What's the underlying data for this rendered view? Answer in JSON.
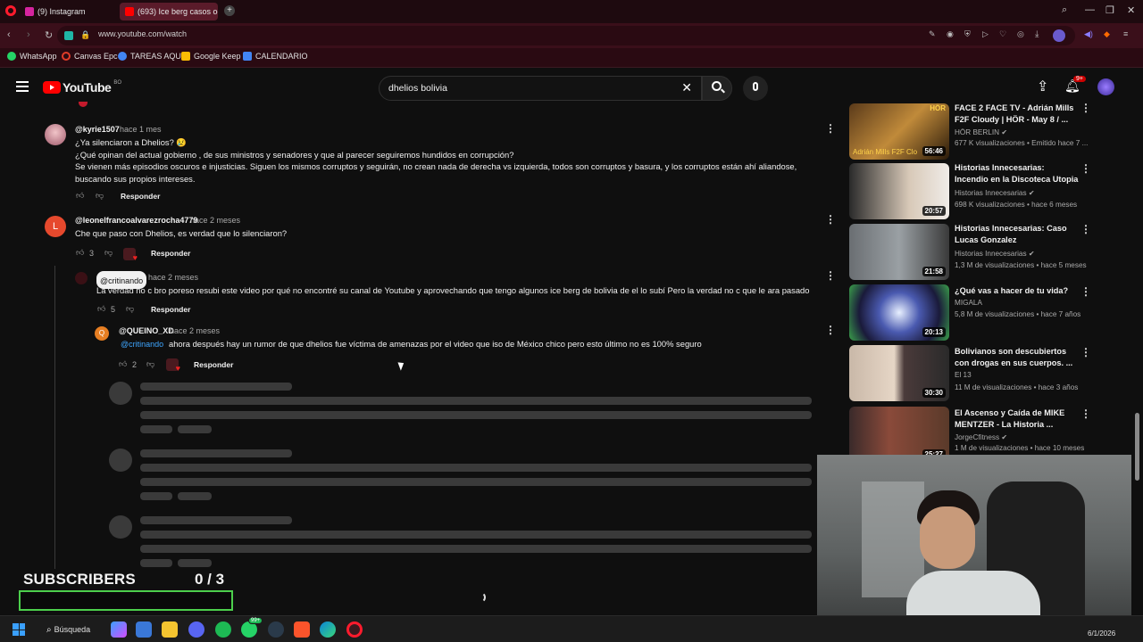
{
  "browser": {
    "tabs": [
      {
        "label": "(9) Instagram",
        "color": "#d6249f"
      },
      {
        "label": "(693) Ice berg casos ocurr",
        "color": "#ff0000"
      }
    ],
    "url": "www.youtube.com/watch",
    "bookmarks": [
      {
        "label": "WhatsApp",
        "color": "#25d366"
      },
      {
        "label": "Canvas Epc",
        "color": "#e13c28"
      },
      {
        "label": "TAREAS AQUI",
        "color": "#4285f4"
      },
      {
        "label": "Google Keep",
        "color": "#fbbc04"
      },
      {
        "label": "CALENDARIO",
        "color": "#4285f4"
      }
    ]
  },
  "youtube": {
    "logo_text": "YouTube",
    "logo_region": "BO",
    "search_value": "dhelios bolivia",
    "notification_badge": "9+"
  },
  "comments": [
    {
      "handle": "@kyrie1507",
      "time": "hace 1 mes",
      "lines": [
        "¿Ya silenciaron a Dhelios? 😢",
        "¿Qué opinan del actual gobierno , de sus ministros y senadores y que al parecer seguiremos hundidos en corrupción?",
        "Se vienen más episodios oscuros e injusticias. Siguen los mismos corruptos y seguirán, no crean nada de derecha vs izquierda, todos son corruptos y basura, y los corruptos están ahí aliandose, buscando sus propios intereses."
      ],
      "likes": "",
      "reply_label": "Responder"
    },
    {
      "handle": "@leonelfrancoalvarezrocha4779",
      "time": "hace 2 meses",
      "text": "Che que paso con Dhelios, es verdad que lo silenciaron?",
      "likes": "3",
      "reply_label": "Responder",
      "avatar_letter": "L"
    },
    {
      "handle": "@critinando",
      "time": "hace 2 meses",
      "text": "La verdad no c bro poreso resubi este video por qué no encontré su canal de Youtube y aprovechando que tengo algunos ice berg de bolivia de el lo subí Pero la verdad no c que le ara pasado",
      "likes": "5",
      "reply_label": "Responder"
    },
    {
      "handle": "@QUEINO_XD",
      "time": "hace 2 meses",
      "mention": "@critinando",
      "text": "ahora después hay un rumor de que dhelios fue víctima de amenazas por el video que iso de México chico pero esto último no es 100% seguro",
      "likes": "2",
      "reply_label": "Responder",
      "avatar_letter": "Q"
    }
  ],
  "sidebar_videos": [
    {
      "title": "FACE 2 FACE TV - Adrián Mills F2F Cloudy | HÖR - May 8 / ...",
      "channel": "HÖR BERLIN",
      "meta": "677 K visualizaciones • Emitido hace 7 ...",
      "duration": "56:46",
      "thumb_caption": "Adrián Mills F2F Clo",
      "thumb_tag": "HÖR"
    },
    {
      "title": "Historias Innecesarias: Incendio en la Discoteca Utopia",
      "channel": "Historias Innecesarias",
      "meta": "698 K visualizaciones • hace 6 meses",
      "duration": "20:57"
    },
    {
      "title": "Historias Innecesarias: Caso Lucas Gonzalez",
      "channel": "Historias Innecesarias",
      "meta": "1,3 M de visualizaciones • hace 5 meses",
      "duration": "21:58"
    },
    {
      "title": "¿Qué vas a hacer de tu vida?",
      "channel": "MIGALA",
      "meta": "5,8 M de visualizaciones • hace 7 años",
      "duration": "20:13"
    },
    {
      "title": "Bolivianos son descubiertos con drogas en sus cuerpos. ...",
      "channel": "El 13",
      "meta": "11 M de visualizaciones • hace 3 años",
      "duration": "30:30"
    },
    {
      "title": "El Ascenso y Caída de MIKE MENTZER - La Historia ...",
      "channel": "JorgeCfitness",
      "meta": "1 M de visualizaciones • hace 10 meses",
      "duration": "25:27"
    }
  ],
  "overlay": {
    "subscribers_label": "SUBSCRIBERS",
    "subscribers_count": "0 / 3",
    "subscribers_progress": 0
  },
  "taskbar": {
    "search_label": "Búsqueda",
    "whatsapp_badge": "99+",
    "date": "6/1/2026"
  }
}
